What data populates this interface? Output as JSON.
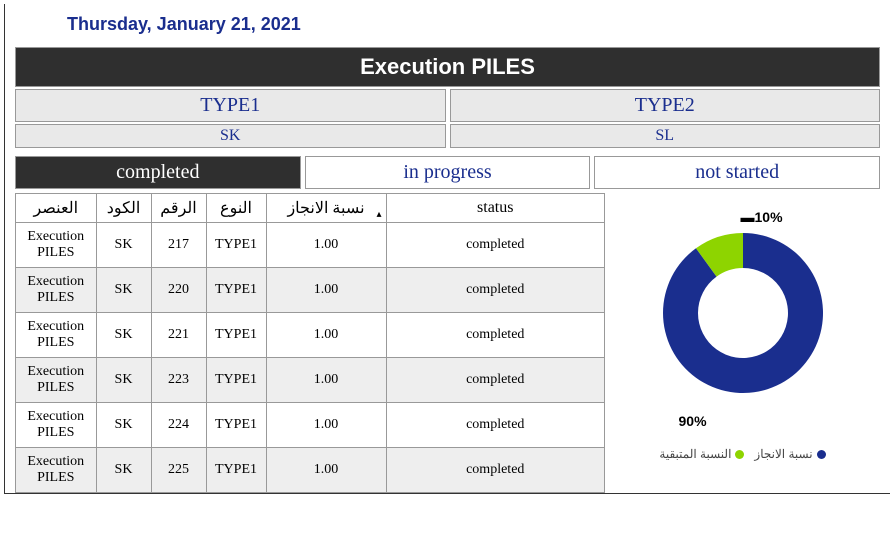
{
  "date": "Thursday, January 21, 2021",
  "title": "Execution PILES",
  "types": {
    "type1": "TYPE1",
    "type2": "TYPE2"
  },
  "codes": {
    "c1": "SK",
    "c2": "SL"
  },
  "tabs": {
    "completed": "completed",
    "in_progress": "in progress",
    "not_started": "not started"
  },
  "table": {
    "headers": {
      "element": "العنصر",
      "code": "الكود",
      "num": "الرقم",
      "type": "النوع",
      "pct": "نسبة الانجاز",
      "status": "status"
    },
    "rows": [
      {
        "element": "Execution PILES",
        "code": "SK",
        "num": "217",
        "type": "TYPE1",
        "pct": "1.00",
        "status": "completed"
      },
      {
        "element": "Execution PILES",
        "code": "SK",
        "num": "220",
        "type": "TYPE1",
        "pct": "1.00",
        "status": "completed"
      },
      {
        "element": "Execution PILES",
        "code": "SK",
        "num": "221",
        "type": "TYPE1",
        "pct": "1.00",
        "status": "completed"
      },
      {
        "element": "Execution PILES",
        "code": "SK",
        "num": "223",
        "type": "TYPE1",
        "pct": "1.00",
        "status": "completed"
      },
      {
        "element": "Execution PILES",
        "code": "SK",
        "num": "224",
        "type": "TYPE1",
        "pct": "1.00",
        "status": "completed"
      },
      {
        "element": "Execution PILES",
        "code": "SK",
        "num": "225",
        "type": "TYPE1",
        "pct": "1.00",
        "status": "completed"
      }
    ]
  },
  "chart_data": {
    "type": "pie",
    "title": "",
    "series": [
      {
        "name": "نسبة الانجاز",
        "value": 90,
        "color": "#1a2e8e"
      },
      {
        "name": "النسبة المتبقية",
        "value": 10,
        "color": "#8ed400"
      }
    ],
    "labels": {
      "top": "10%",
      "bottom": "90%"
    },
    "legend": {
      "done": "نسبة الانجاز",
      "remain": "النسبة المتبقية"
    }
  }
}
